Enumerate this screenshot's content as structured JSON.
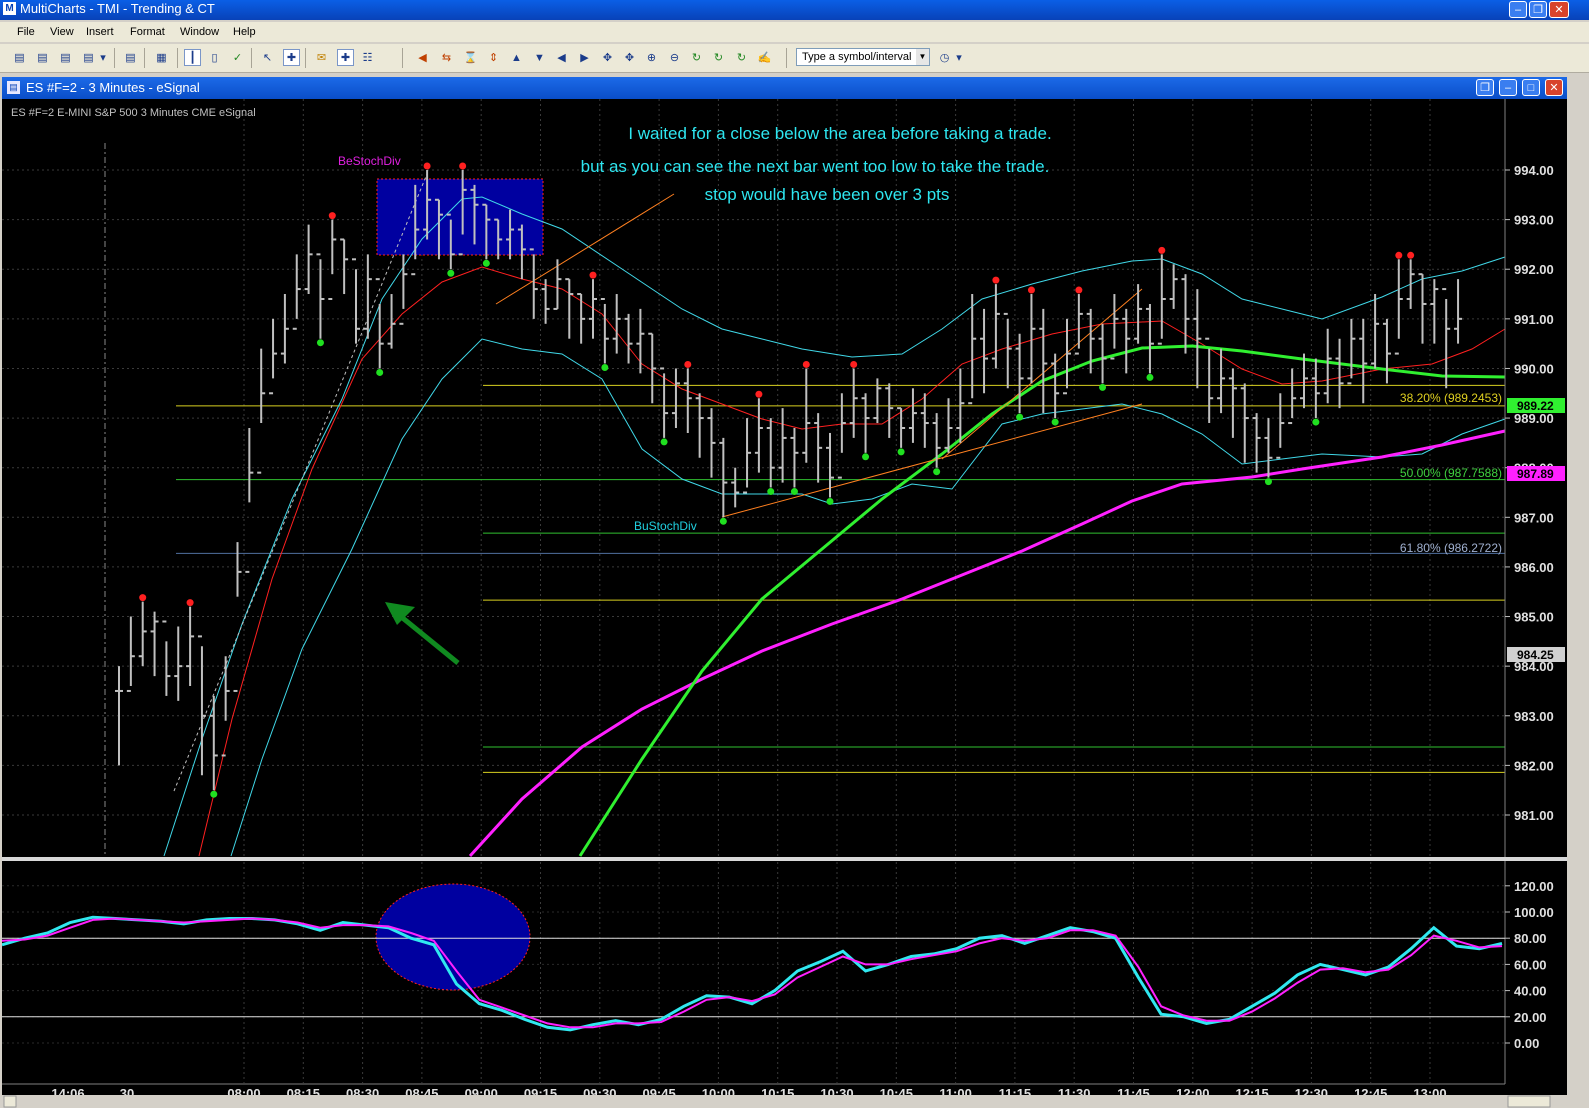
{
  "window": {
    "title": "MultiCharts - TMI - Trending & CT",
    "buttons": [
      "minimize",
      "restore",
      "close"
    ]
  },
  "menu": [
    "File",
    "View",
    "Insert",
    "Format",
    "Window",
    "Help"
  ],
  "toolbar": {
    "symbol_input": "Type a symbol/interval",
    "icons": [
      "new-chart-icon",
      "chart-icon",
      "save-icon",
      "print-icon",
      "sound-icon",
      "tile-icon",
      "bars-icon",
      "candles-icon",
      "check-icon",
      "pointer-icon",
      "crosshair-icon",
      "comment-icon",
      "drawing-icon",
      "zoom-icon",
      "scroll-left-icon",
      "arrows-icon",
      "hourglass-icon",
      "up-icon",
      "down-icon",
      "left-icon",
      "right-icon",
      "move-icon",
      "fit-icon",
      "zoom-in-icon",
      "zoom-out-icon",
      "refresh-icon",
      "refresh-all-icon",
      "refresh-status-icon",
      "mouse-icon",
      "time-icon"
    ]
  },
  "chart_window": {
    "title": "ES #F=2 - 3 Minutes - eSignal",
    "info": "ES #F=2  E-MINI S&P 500  3 Minutes  CME  eSignal"
  },
  "annotations": {
    "line1": "I waited for a close below the area before taking a trade.",
    "line2": "but as you can see the next bar went too low to take the trade.",
    "line3": "stop would have been over 3 pts",
    "bear_div": "BeStochDiv",
    "bull_div": "BuStochDiv"
  },
  "fib_labels": {
    "f382": "38.20% (989.2453)",
    "f500": "50.00% (987.7588)",
    "f618": "61.80% (986.2722)"
  },
  "price_tags": {
    "green": "989.22",
    "magenta": "987.89",
    "gray": "984.25"
  },
  "colors": {
    "annotation": "#2ee6f0",
    "bars": "#c0c0c0",
    "ema_red": "#ff2020",
    "band_cyan": "#40d8e8",
    "ma_green": "#30f030",
    "ma_magenta": "#ff20ff",
    "fib_yellow": "#d8d020",
    "fib_green": "#30c030"
  },
  "chart_data": [
    {
      "type": "line",
      "instrument": "ES #F=2",
      "interval": "3 Minutes",
      "y_tick_labels": [
        "994.00",
        "993.00",
        "992.00",
        "991.00",
        "990.00",
        "989.00",
        "988.00",
        "987.00",
        "986.00",
        "985.00",
        "984.00",
        "983.00",
        "982.00",
        "981.00"
      ],
      "ylim": [
        980.3,
        995.2
      ],
      "x_tick_labels": [
        "14:06",
        "30",
        "08:00",
        "08:15",
        "08:30",
        "08:45",
        "09:00",
        "09:15",
        "09:30",
        "09:45",
        "10:00",
        "10:15",
        "10:30",
        "10:45",
        "11:00",
        "11:15",
        "11:30",
        "11:45",
        "12:00",
        "12:15",
        "12:30",
        "12:45",
        "13:00"
      ],
      "closes": [
        983.5,
        984.2,
        984.7,
        984.9,
        983.8,
        984.0,
        984.6,
        983.0,
        982.2,
        983.5,
        985.9,
        987.9,
        989.5,
        990.3,
        990.8,
        991.6,
        992.3,
        991.4,
        992.6,
        992.2,
        990.8,
        991.8,
        990.5,
        990.9,
        991.9,
        992.8,
        993.4,
        993.1,
        992.3,
        993.6,
        993.3,
        993.0,
        992.6,
        992.8,
        992.4,
        991.6,
        991.2,
        991.8,
        991.5,
        991.0,
        991.4,
        990.6,
        991.0,
        990.5,
        990.7,
        990.0,
        989.1,
        989.7,
        989.4,
        989.0,
        988.5,
        987.7,
        987.5,
        988.3,
        988.8,
        988.0,
        988.6,
        988.3,
        988.9,
        988.4,
        987.8,
        988.9,
        989.4,
        989.0,
        989.6,
        989.2,
        988.8,
        989.1,
        988.9,
        988.4,
        988.8,
        989.3,
        990.6,
        990.2,
        991.1,
        990.4,
        989.8,
        990.8,
        990.1,
        989.5,
        990.3,
        991.1,
        990.6,
        990.2,
        991.0,
        990.6,
        991.2,
        990.5,
        991.4,
        991.8,
        991.0,
        990.6,
        989.4,
        989.8,
        989.6,
        989.0,
        988.6,
        988.2,
        988.9,
        989.4,
        989.8,
        989.5,
        990.2,
        989.7,
        990.6,
        990.1,
        990.9,
        990.3,
        991.4,
        991.9,
        991.3,
        991.6,
        990.8,
        991.0
      ],
      "bar_high": [
        984.0,
        985.0,
        985.3,
        985.1,
        984.5,
        984.8,
        985.2,
        984.4,
        983.4,
        984.2,
        986.5,
        988.8,
        990.4,
        991.0,
        991.5,
        992.3,
        992.9,
        992.2,
        993.0,
        992.6,
        992.0,
        992.3,
        991.3,
        991.5,
        992.3,
        993.7,
        994.0,
        993.4,
        993.0,
        994.0,
        993.7,
        993.3,
        993.0,
        993.2,
        992.9,
        992.3,
        991.8,
        992.2,
        991.8,
        991.5,
        991.8,
        991.3,
        991.5,
        991.1,
        991.2,
        990.7,
        989.9,
        990.0,
        990.0,
        989.5,
        989.2,
        988.6,
        988.0,
        989.0,
        989.4,
        989.0,
        989.2,
        988.8,
        990.0,
        989.1,
        988.7,
        989.5,
        990.0,
        989.5,
        989.8,
        989.7,
        989.2,
        989.6,
        989.5,
        989.1,
        989.4,
        990.0,
        991.5,
        991.2,
        991.7,
        991.0,
        990.7,
        991.5,
        991.2,
        990.3,
        991.0,
        991.5,
        991.2,
        990.9,
        991.5,
        991.2,
        991.7,
        991.3,
        992.3,
        992.1,
        991.9,
        991.6,
        990.4,
        990.4,
        990.0,
        989.7,
        989.1,
        989.0,
        989.5,
        990.0,
        990.3,
        990.2,
        990.8,
        990.6,
        991.0,
        991.0,
        991.5,
        991.0,
        992.2,
        992.2,
        991.9,
        991.8,
        991.4,
        991.8
      ],
      "bar_low": [
        982.0,
        983.6,
        984.0,
        983.8,
        983.4,
        983.3,
        983.6,
        981.8,
        981.5,
        982.9,
        985.4,
        987.3,
        988.9,
        989.8,
        990.1,
        991.0,
        991.5,
        990.6,
        991.9,
        991.5,
        990.5,
        990.6,
        990.0,
        990.4,
        991.2,
        992.2,
        992.6,
        992.2,
        992.0,
        992.7,
        992.5,
        992.2,
        992.2,
        992.2,
        991.8,
        991.0,
        990.9,
        991.2,
        990.6,
        990.5,
        990.6,
        990.1,
        990.3,
        990.1,
        989.9,
        989.3,
        988.6,
        988.8,
        988.7,
        988.2,
        987.8,
        987.0,
        987.2,
        987.6,
        987.9,
        987.6,
        987.7,
        987.6,
        988.1,
        987.7,
        987.4,
        988.3,
        988.6,
        988.3,
        988.9,
        988.6,
        988.4,
        988.5,
        988.4,
        988.0,
        988.3,
        988.5,
        989.4,
        989.5,
        990.0,
        989.6,
        989.1,
        989.7,
        989.1,
        989.0,
        989.6,
        990.4,
        989.9,
        989.7,
        990.4,
        989.9,
        990.5,
        989.9,
        990.6,
        991.2,
        990.3,
        989.6,
        988.9,
        989.1,
        988.6,
        988.1,
        987.9,
        987.8,
        988.4,
        989.0,
        989.2,
        989.0,
        989.3,
        989.2,
        989.8,
        989.3,
        990.0,
        989.7,
        990.6,
        991.2,
        990.5,
        990.5,
        989.6,
        990.5
      ],
      "fib_levels": [
        989.2453,
        987.7588,
        986.2722
      ],
      "extra_levels": [
        989.66,
        986.68,
        985.33,
        982.37,
        981.86
      ],
      "last_prices": [
        989.22,
        987.89,
        984.25
      ]
    },
    {
      "type": "line",
      "indicator": "Stochastic",
      "y_tick_labels": [
        "120.00",
        "100.00",
        "80.00",
        "60.00",
        "40.00",
        "20.00",
        "0.00"
      ],
      "ylim": [
        -10,
        130
      ],
      "levels": [
        80,
        20
      ],
      "k_values": [
        75,
        80,
        84,
        92,
        96,
        95,
        94,
        93,
        91,
        94,
        95,
        95,
        94,
        91,
        86,
        92,
        90,
        88,
        80,
        75,
        45,
        30,
        25,
        18,
        12,
        10,
        14,
        17,
        14,
        18,
        28,
        36,
        35,
        30,
        40,
        55,
        62,
        70,
        55,
        60,
        66,
        68,
        72,
        80,
        82,
        76,
        82,
        88,
        85,
        80,
        50,
        22,
        20,
        15,
        18,
        28,
        38,
        52,
        60,
        56,
        52,
        58,
        72,
        88,
        74,
        72,
        76
      ],
      "d_values": [
        78,
        79,
        82,
        88,
        94,
        95,
        94,
        93,
        92,
        93,
        94,
        95,
        94,
        92,
        88,
        90,
        90,
        89,
        84,
        78,
        55,
        33,
        27,
        21,
        15,
        12,
        12,
        15,
        15,
        16,
        24,
        33,
        35,
        32,
        37,
        50,
        58,
        66,
        60,
        60,
        64,
        67,
        70,
        76,
        80,
        78,
        80,
        86,
        86,
        82,
        58,
        28,
        21,
        17,
        17,
        24,
        34,
        46,
        56,
        57,
        54,
        56,
        67,
        82,
        78,
        73,
        74
      ]
    }
  ]
}
